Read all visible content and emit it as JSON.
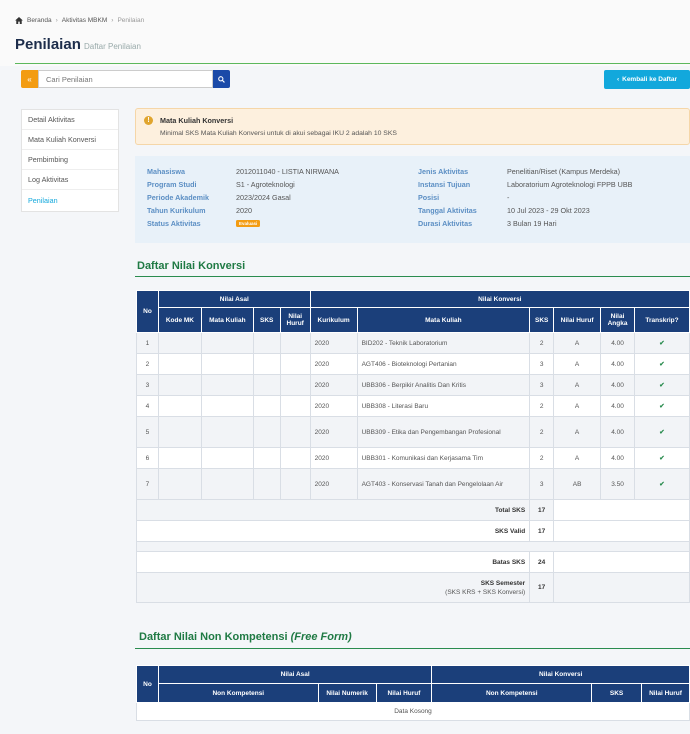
{
  "breadcrumb": {
    "home": "Beranda",
    "aktivitas": "Aktivitas MBKM",
    "current": "Penilaian"
  },
  "page": {
    "title": "Penilaian",
    "subtitle": "Daftar Penilaian"
  },
  "search": {
    "placeholder": "Cari Penilaian"
  },
  "back_button": "Kembali ke Daftar",
  "sidebar": {
    "items": [
      {
        "label": "Detail Aktivitas"
      },
      {
        "label": "Mata Kuliah Konversi"
      },
      {
        "label": "Pembimbing"
      },
      {
        "label": "Log Aktivitas"
      },
      {
        "label": "Penilaian"
      }
    ]
  },
  "alert": {
    "title": "Mata Kuliah Konversi",
    "text": "Minimal SKS Mata Kuliah Konversi untuk di akui sebagai IKU 2 adalah 10 SKS"
  },
  "info": {
    "mahasiswa_label": "Mahasiswa",
    "mahasiswa": "2012011040 - LISTIA NIRWANA",
    "prodi_label": "Program Studi",
    "prodi": "S1 - Agroteknologi",
    "periode_label": "Periode Akademik",
    "periode": "2023/2024 Gasal",
    "kurikulum_label": "Tahun Kurikulum",
    "kurikulum": "2020",
    "status_label": "Status Aktivitas",
    "status": "Evaluasi",
    "jenis_label": "Jenis Aktivitas",
    "jenis": "Penelitian/Riset (Kampus Merdeka)",
    "instansi_label": "Instansi Tujuan",
    "instansi": "Laboratorium Agroteknologi FPPB UBB",
    "posisi_label": "Posisi",
    "posisi": "-",
    "tanggal_label": "Tanggal Aktivitas",
    "tanggal": "10 Jul 2023 - 29 Okt 2023",
    "durasi_label": "Durasi Aktivitas",
    "durasi": "3 Bulan 19 Hari"
  },
  "konversi": {
    "title": "Daftar Nilai Konversi",
    "head": {
      "no": "No",
      "nilai_asal": "Nilai Asal",
      "nilai_konversi": "Nilai Konversi",
      "kode_mk": "Kode MK",
      "mata_kuliah": "Mata Kuliah",
      "sks": "SKS",
      "nilai_huruf": "Nilai Huruf",
      "kurikulum": "Kurikulum",
      "nilai_angka": "Nilai Angka",
      "transkrip": "Transkrip?"
    },
    "rows": [
      {
        "no": "1",
        "kurikulum": "2020",
        "mk": "BID202 - Teknik Laboratorium",
        "sks": "2",
        "huruf": "A",
        "angka": "4.00"
      },
      {
        "no": "2",
        "kurikulum": "2020",
        "mk": "AGT406 - Bioteknologi Pertanian",
        "sks": "3",
        "huruf": "A",
        "angka": "4.00"
      },
      {
        "no": "3",
        "kurikulum": "2020",
        "mk": "UBB306 - Berpikir Analitis Dan Kritis",
        "sks": "3",
        "huruf": "A",
        "angka": "4.00"
      },
      {
        "no": "4",
        "kurikulum": "2020",
        "mk": "UBB308 - Literasi Baru",
        "sks": "2",
        "huruf": "A",
        "angka": "4.00"
      },
      {
        "no": "5",
        "kurikulum": "2020",
        "mk": "UBB309 - Etika dan Pengembangan Profesional",
        "sks": "2",
        "huruf": "A",
        "angka": "4.00"
      },
      {
        "no": "6",
        "kurikulum": "2020",
        "mk": "UBB301 - Komunikasi dan Kerjasama Tim",
        "sks": "2",
        "huruf": "A",
        "angka": "4.00"
      },
      {
        "no": "7",
        "kurikulum": "2020",
        "mk": "AGT403 - Konservasi Tanah dan Pengelolaan Air",
        "sks": "3",
        "huruf": "AB",
        "angka": "3.50"
      }
    ],
    "total_sks_label": "Total SKS",
    "total_sks": "17",
    "sks_valid_label": "SKS Valid",
    "sks_valid": "17",
    "batas_sks_label": "Batas SKS",
    "batas_sks": "24",
    "sks_semester_label": "SKS Semester",
    "sks_semester_note": "(SKS KRS + SKS Konversi)",
    "sks_semester": "17"
  },
  "non_kompetensi": {
    "title": "Daftar Nilai Non Kompetensi",
    "title_em": "(Free Form)",
    "head": {
      "no": "No",
      "nilai_asal": "Nilai Asal",
      "nilai_konversi": "Nilai Konversi",
      "non_kompetensi": "Non Kompetensi",
      "nilai_numerik": "Nilai Numerik",
      "nilai_huruf": "Nilai Huruf",
      "non_kompetensi2": "Non Kompetensi",
      "sks": "SKS",
      "nilai_huruf2": "Nilai Huruf"
    },
    "empty": "Data Kosong"
  },
  "colors": {
    "primary": "#1b3f7a",
    "accent": "#12a8dc",
    "green": "#2a8c4f",
    "orange": "#f39c12"
  }
}
